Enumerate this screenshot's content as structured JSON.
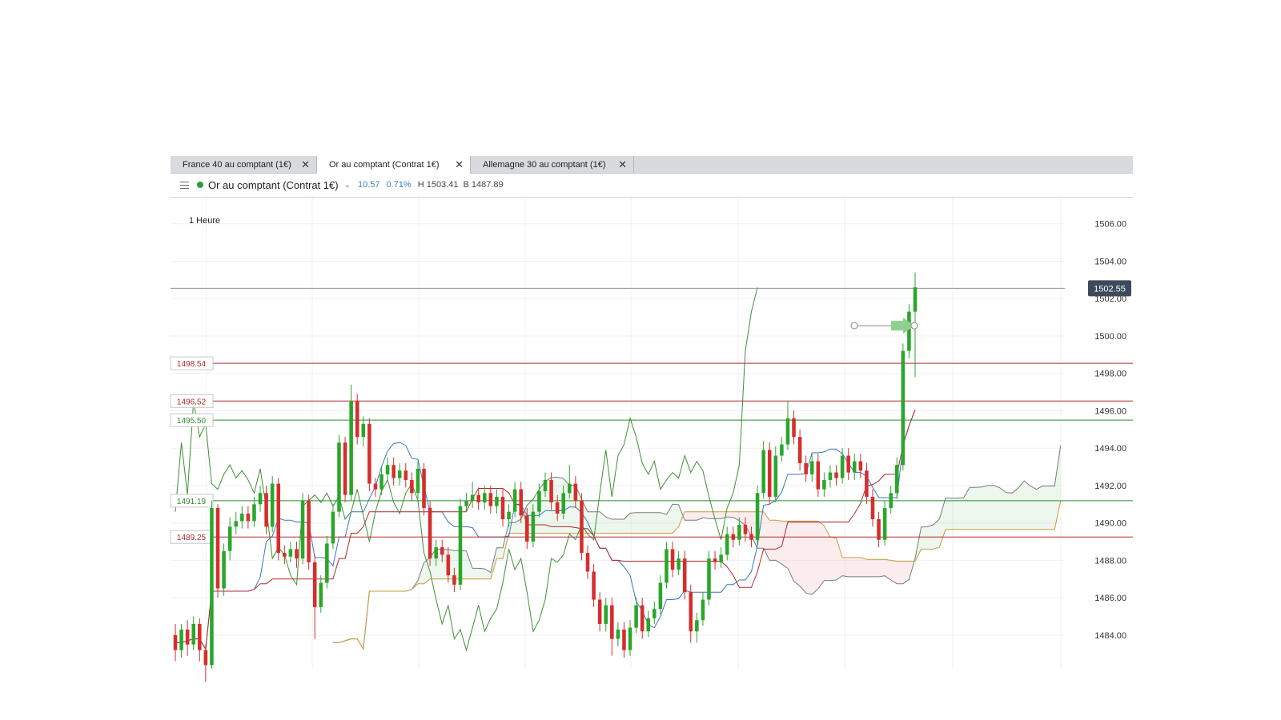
{
  "tabs": [
    {
      "label": "France 40 au comptant (1€)",
      "active": false
    },
    {
      "label": "Or au comptant (Contrat 1€)",
      "active": true
    },
    {
      "label": "Allemagne 30 au comptant (1€)",
      "active": false
    }
  ],
  "tab_close_glyph": "✕",
  "instrument": {
    "name": "Or au comptant (Contrat 1€)",
    "change": "10.57",
    "change_pct": "0.71%",
    "high": "H 1503.41",
    "low": "B 1487.89",
    "status_color": "#2c9a3c"
  },
  "timeframe": "1 Heure",
  "chart_data": {
    "type": "candlestick",
    "y_axis": {
      "min": 1482.2,
      "max": 1507.4,
      "ticks": [
        "1506.00",
        "1504.00",
        "1502.00",
        "1500.00",
        "1498.00",
        "1496.00",
        "1494.00",
        "1492.00",
        "1490.00",
        "1488.00",
        "1486.00",
        "1484.00"
      ],
      "grid": true,
      "position": "right"
    },
    "current_price": {
      "value": 1502.55,
      "label": "1502.55",
      "color": "#3d4a5c"
    },
    "horizontal_levels": [
      {
        "value": 1498.54,
        "label": "1498.54",
        "color": "#b22a2a"
      },
      {
        "value": 1496.52,
        "label": "1496.52",
        "color": "#b22a2a"
      },
      {
        "value": 1495.5,
        "label": "1495.50",
        "color": "#2e8a30"
      },
      {
        "value": 1491.19,
        "label": "1491.19",
        "color": "#2e8a30"
      },
      {
        "value": 1489.25,
        "label": "1489.25",
        "color": "#b22a2a"
      }
    ],
    "candles": [
      [
        1484,
        1483.2,
        1484.6,
        1482.6
      ],
      [
        1483.2,
        1484.3,
        1484.6,
        1482.8
      ],
      [
        1484.3,
        1483.5,
        1484.8,
        1482.9
      ],
      [
        1483.5,
        1484.6,
        1485,
        1483.2
      ],
      [
        1484.6,
        1483.2,
        1484.9,
        1482.6
      ],
      [
        1483.2,
        1482.4,
        1483.5,
        1481.5
      ],
      [
        1482.4,
        1490.8,
        1491.2,
        1482.2
      ],
      [
        1490.8,
        1486.5,
        1491,
        1486
      ],
      [
        1486.5,
        1488.5,
        1488.9,
        1486.1
      ],
      [
        1488.5,
        1489.8,
        1490.3,
        1488
      ],
      [
        1489.8,
        1490.1,
        1490.6,
        1489.4
      ],
      [
        1490.1,
        1490.5,
        1490.9,
        1489.7
      ],
      [
        1490.5,
        1490.1,
        1490.9,
        1489.7
      ],
      [
        1490.1,
        1491,
        1491.4,
        1489.8
      ],
      [
        1491,
        1491.6,
        1492,
        1490.6
      ],
      [
        1491.6,
        1489.8,
        1492,
        1489.4
      ],
      [
        1489.8,
        1492.1,
        1492.5,
        1489.5
      ],
      [
        1492.1,
        1488.4,
        1492.4,
        1488
      ],
      [
        1488.4,
        1488.2,
        1488.8,
        1487.8
      ],
      [
        1488.2,
        1488.6,
        1489,
        1487.9
      ],
      [
        1488.6,
        1488.1,
        1489,
        1487.6
      ],
      [
        1488.1,
        1491.2,
        1491.6,
        1487.8
      ],
      [
        1491.2,
        1487.9,
        1491.5,
        1487.5
      ],
      [
        1487.9,
        1485.5,
        1488.3,
        1483.8
      ],
      [
        1485.5,
        1486.8,
        1487.2,
        1485.2
      ],
      [
        1486.8,
        1488.9,
        1489.3,
        1486.5
      ],
      [
        1488.9,
        1490.6,
        1491,
        1488.6
      ],
      [
        1490.6,
        1494.3,
        1494.7,
        1490.3
      ],
      [
        1494.3,
        1491.5,
        1494.6,
        1491.1
      ],
      [
        1491.5,
        1496.5,
        1497.4,
        1491.2
      ],
      [
        1496.5,
        1494.6,
        1496.9,
        1494.2
      ],
      [
        1494.6,
        1495.3,
        1495.7,
        1494.1
      ],
      [
        1495.3,
        1492.1,
        1495.6,
        1491.7
      ],
      [
        1492.1,
        1491.8,
        1492.4,
        1491.4
      ],
      [
        1491.8,
        1492.6,
        1493,
        1491.5
      ],
      [
        1492.6,
        1493.1,
        1493.5,
        1492.3
      ],
      [
        1493.1,
        1492.4,
        1493.5,
        1492
      ],
      [
        1492.4,
        1492.8,
        1493.2,
        1492
      ],
      [
        1492.8,
        1492.3,
        1493.2,
        1491.9
      ],
      [
        1492.3,
        1491.6,
        1492.7,
        1491.2
      ],
      [
        1491.6,
        1492.9,
        1493.3,
        1491.3
      ],
      [
        1492.9,
        1490.8,
        1493.2,
        1490.4
      ],
      [
        1490.8,
        1488.1,
        1491.2,
        1487.7
      ],
      [
        1488.1,
        1488.7,
        1489.1,
        1487.7
      ],
      [
        1488.7,
        1488.3,
        1489.1,
        1487.9
      ],
      [
        1488.3,
        1487.2,
        1488.7,
        1486.8
      ],
      [
        1487.2,
        1486.7,
        1487.6,
        1486.3
      ],
      [
        1486.7,
        1490.9,
        1491.3,
        1486.4
      ],
      [
        1490.9,
        1491.2,
        1491.6,
        1490.6
      ],
      [
        1491.2,
        1491.5,
        1492.2,
        1490.8
      ],
      [
        1491.5,
        1491.1,
        1491.9,
        1490.7
      ],
      [
        1491.1,
        1491.6,
        1492,
        1490.7
      ],
      [
        1491.6,
        1490.9,
        1492,
        1490.5
      ],
      [
        1490.9,
        1491.4,
        1491.8,
        1490.5
      ],
      [
        1491.4,
        1490.2,
        1491.8,
        1489.8
      ],
      [
        1490.2,
        1490.6,
        1491,
        1489.8
      ],
      [
        1490.6,
        1491.8,
        1492.2,
        1490.3
      ],
      [
        1491.8,
        1490.4,
        1492.2,
        1490
      ],
      [
        1490.4,
        1489,
        1490.8,
        1488.6
      ],
      [
        1489,
        1490.6,
        1491,
        1488.7
      ],
      [
        1490.6,
        1491.7,
        1492.1,
        1490.3
      ],
      [
        1491.7,
        1492.3,
        1492.7,
        1491.4
      ],
      [
        1492.3,
        1491.1,
        1492.7,
        1490.7
      ],
      [
        1491.1,
        1490.5,
        1491.5,
        1490.1
      ],
      [
        1490.5,
        1491.6,
        1492,
        1490.2
      ],
      [
        1491.6,
        1492.1,
        1493.1,
        1491.3
      ],
      [
        1492.1,
        1491.2,
        1492.5,
        1490.8
      ],
      [
        1491.2,
        1488.4,
        1491.6,
        1488
      ],
      [
        1488.4,
        1487.4,
        1488.8,
        1487
      ],
      [
        1487.4,
        1485.9,
        1487.8,
        1485.5
      ],
      [
        1485.9,
        1484.6,
        1486.3,
        1484.2
      ],
      [
        1484.6,
        1485.6,
        1486,
        1484.2
      ],
      [
        1485.6,
        1483.8,
        1486,
        1482.9
      ],
      [
        1483.8,
        1484.3,
        1484.7,
        1483.4
      ],
      [
        1484.3,
        1483.2,
        1484.7,
        1482.8
      ],
      [
        1483.2,
        1484.4,
        1484.8,
        1482.9
      ],
      [
        1484.4,
        1485.6,
        1486,
        1484.1
      ],
      [
        1485.6,
        1484.2,
        1486,
        1483.8
      ],
      [
        1484.2,
        1484.9,
        1485.3,
        1483.9
      ],
      [
        1484.9,
        1485.4,
        1485.8,
        1484.6
      ],
      [
        1485.4,
        1486.8,
        1487.2,
        1485.1
      ],
      [
        1486.8,
        1488.6,
        1489,
        1486.5
      ],
      [
        1488.6,
        1487.5,
        1489,
        1487.1
      ],
      [
        1487.5,
        1488.1,
        1488.5,
        1487.2
      ],
      [
        1488.1,
        1486.3,
        1488.5,
        1485.9
      ],
      [
        1486.3,
        1484.2,
        1486.7,
        1483.6
      ],
      [
        1484.2,
        1484.8,
        1485.2,
        1483.6
      ],
      [
        1484.8,
        1485.9,
        1486.3,
        1484.5
      ],
      [
        1485.9,
        1488.1,
        1488.5,
        1485.6
      ],
      [
        1488.1,
        1487.9,
        1488.5,
        1487.5
      ],
      [
        1487.9,
        1488.3,
        1488.7,
        1487.6
      ],
      [
        1488.3,
        1489.4,
        1489.8,
        1488
      ],
      [
        1489.4,
        1489.1,
        1489.8,
        1488.7
      ],
      [
        1489.1,
        1489.9,
        1490.3,
        1488.8
      ],
      [
        1489.9,
        1489.4,
        1490.3,
        1489
      ],
      [
        1489.4,
        1489.1,
        1489.8,
        1488.7
      ],
      [
        1489.1,
        1491.6,
        1492,
        1488.8
      ],
      [
        1491.6,
        1493.9,
        1494.4,
        1491.3
      ],
      [
        1493.9,
        1491.4,
        1494.3,
        1491
      ],
      [
        1491.4,
        1493.6,
        1494.1,
        1491.1
      ],
      [
        1493.6,
        1494.2,
        1494.6,
        1493.3
      ],
      [
        1494.2,
        1495.6,
        1496.5,
        1493.9
      ],
      [
        1495.6,
        1494.6,
        1496,
        1494.2
      ],
      [
        1494.6,
        1493.2,
        1495,
        1492.8
      ],
      [
        1493.2,
        1492.6,
        1493.6,
        1492.2
      ],
      [
        1492.6,
        1493.3,
        1493.7,
        1492.2
      ],
      [
        1493.3,
        1491.8,
        1493.7,
        1491.4
      ],
      [
        1491.8,
        1492.3,
        1492.7,
        1491.4
      ],
      [
        1492.3,
        1492.7,
        1493.1,
        1491.9
      ],
      [
        1492.7,
        1492.4,
        1493.1,
        1492
      ],
      [
        1492.4,
        1493.6,
        1494,
        1492.1
      ],
      [
        1493.6,
        1492.7,
        1494,
        1492.3
      ],
      [
        1492.7,
        1493.3,
        1493.7,
        1492.3
      ],
      [
        1493.3,
        1492.8,
        1493.7,
        1492.4
      ],
      [
        1492.8,
        1491.4,
        1493.2,
        1491
      ],
      [
        1491.4,
        1490.2,
        1491.8,
        1489.8
      ],
      [
        1490.2,
        1489.1,
        1490.6,
        1488.7
      ],
      [
        1489.1,
        1490.8,
        1491.2,
        1488.8
      ],
      [
        1490.8,
        1491.6,
        1492,
        1490.5
      ],
      [
        1491.6,
        1493.1,
        1493.5,
        1491.3
      ],
      [
        1493.1,
        1499.2,
        1499.6,
        1492.8
      ],
      [
        1499.2,
        1501.3,
        1501.7,
        1498.8
      ],
      [
        1501.3,
        1502.6,
        1503.4,
        1497.8
      ]
    ],
    "indicators": [
      "ichimoku-tenkan",
      "ichimoku-kijun",
      "ichimoku-chikou",
      "ichimoku-cloud"
    ],
    "annotation": "arrow-right"
  }
}
